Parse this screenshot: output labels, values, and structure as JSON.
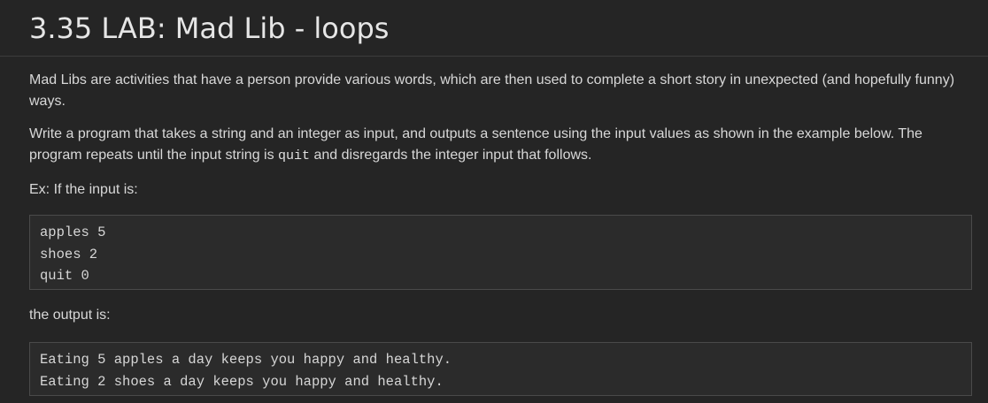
{
  "lab": {
    "title": "3.35 LAB: Mad Lib - loops",
    "intro": "Mad Libs are activities that have a person provide various words, which are then used to complete a short story in unexpected (and hopefully funny) ways.",
    "task_before_code": "Write a program that takes a string and an integer as input, and outputs a sentence using the input values as shown in the example below. The program repeats until the input string is ",
    "task_code": "quit",
    "task_after_code": " and disregards the integer input that follows.",
    "example_input_label": "Ex: If the input is:",
    "example_input_lines": [
      "apples 5",
      "shoes 2",
      "quit 0"
    ],
    "example_output_label": "the output is:",
    "example_output_lines": [
      "Eating 5 apples a day keeps you happy and healthy.",
      "Eating 2 shoes a day keeps you happy and healthy."
    ]
  }
}
